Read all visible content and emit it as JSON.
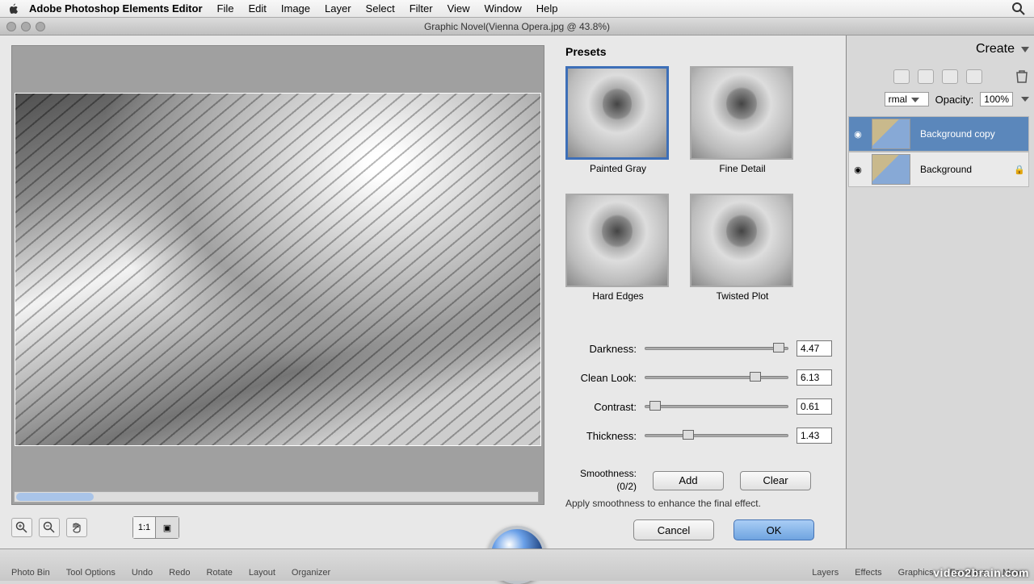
{
  "menubar": {
    "app": "Adobe Photoshop Elements Editor",
    "items": [
      "File",
      "Edit",
      "Image",
      "Layer",
      "Select",
      "Filter",
      "View",
      "Window",
      "Help"
    ]
  },
  "titlebar": {
    "title": "Graphic Novel(Vienna Opera.jpg @ 43.8%)"
  },
  "create": {
    "label": "Create"
  },
  "layermode": {
    "mode": "rmal",
    "opacity_label": "Opacity:",
    "opacity_value": "100%"
  },
  "layers": [
    {
      "name": "Background copy",
      "selected": true
    },
    {
      "name": "Background",
      "selected": false,
      "locked": true
    }
  ],
  "presets": {
    "title": "Presets",
    "items": [
      {
        "label": "Painted Gray",
        "selected": true
      },
      {
        "label": "Fine Detail",
        "selected": false
      },
      {
        "label": "Hard Edges",
        "selected": false
      },
      {
        "label": "Twisted Plot",
        "selected": false
      }
    ]
  },
  "sliders": [
    {
      "label": "Darkness:",
      "value": "4.47",
      "pos": 94
    },
    {
      "label": "Clean Look:",
      "value": "6.13",
      "pos": 77
    },
    {
      "label": "Contrast:",
      "value": "0.61",
      "pos": 7
    },
    {
      "label": "Thickness:",
      "value": "1.43",
      "pos": 30
    }
  ],
  "smoothness": {
    "label": "Smoothness:",
    "count": "(0/2)",
    "add": "Add",
    "clear": "Clear",
    "help": "Apply smoothness to enhance the final effect."
  },
  "buttons": {
    "cancel": "Cancel",
    "ok": "OK"
  },
  "toolbar": {
    "ratio": "1:1"
  },
  "bottombar": {
    "items": [
      "Photo Bin",
      "Tool Options",
      "Undo",
      "Redo",
      "Rotate",
      "Layout",
      "Organizer"
    ],
    "right": [
      "Layers",
      "Effects",
      "Graphics",
      "Favorites",
      "More"
    ]
  },
  "watermark": "video2brain.com"
}
